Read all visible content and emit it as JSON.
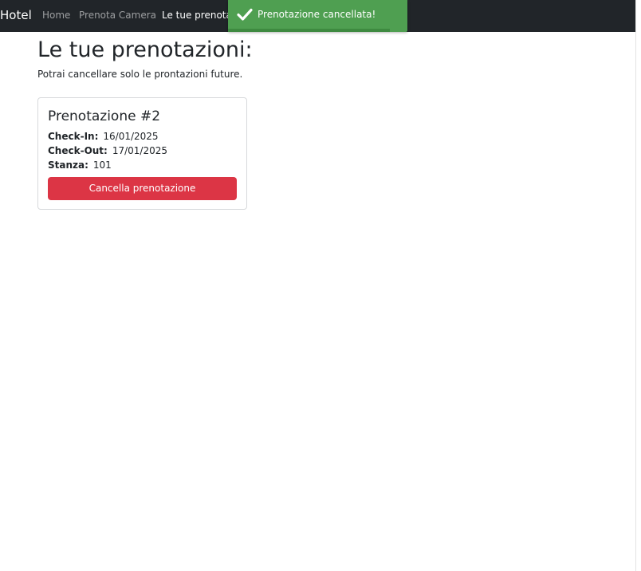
{
  "navbar": {
    "brand": "Hotel",
    "links": [
      {
        "label": "Home",
        "active": false
      },
      {
        "label": "Prenota Camera",
        "active": false
      },
      {
        "label": "Le tue prenotazioni",
        "active": true
      }
    ]
  },
  "toast": {
    "icon": "checkmark-icon",
    "message": "Prenotazione cancellata!",
    "color": "#4f9f51"
  },
  "main": {
    "title": "Le tue prenotazioni:",
    "subtitle": "Potrai cancellare solo le prontazioni future."
  },
  "bookings": [
    {
      "title": "Prenotazione #2",
      "checkin_label": "Check-In:",
      "checkin": "16/01/2025",
      "checkout_label": "Check-Out:",
      "checkout": "17/01/2025",
      "room_label": "Stanza:",
      "room": "101",
      "cancel_label": "Cancella prenotazione"
    }
  ],
  "colors": {
    "navbar": "#212529",
    "danger": "#dc3545",
    "success": "#4f9f51"
  }
}
